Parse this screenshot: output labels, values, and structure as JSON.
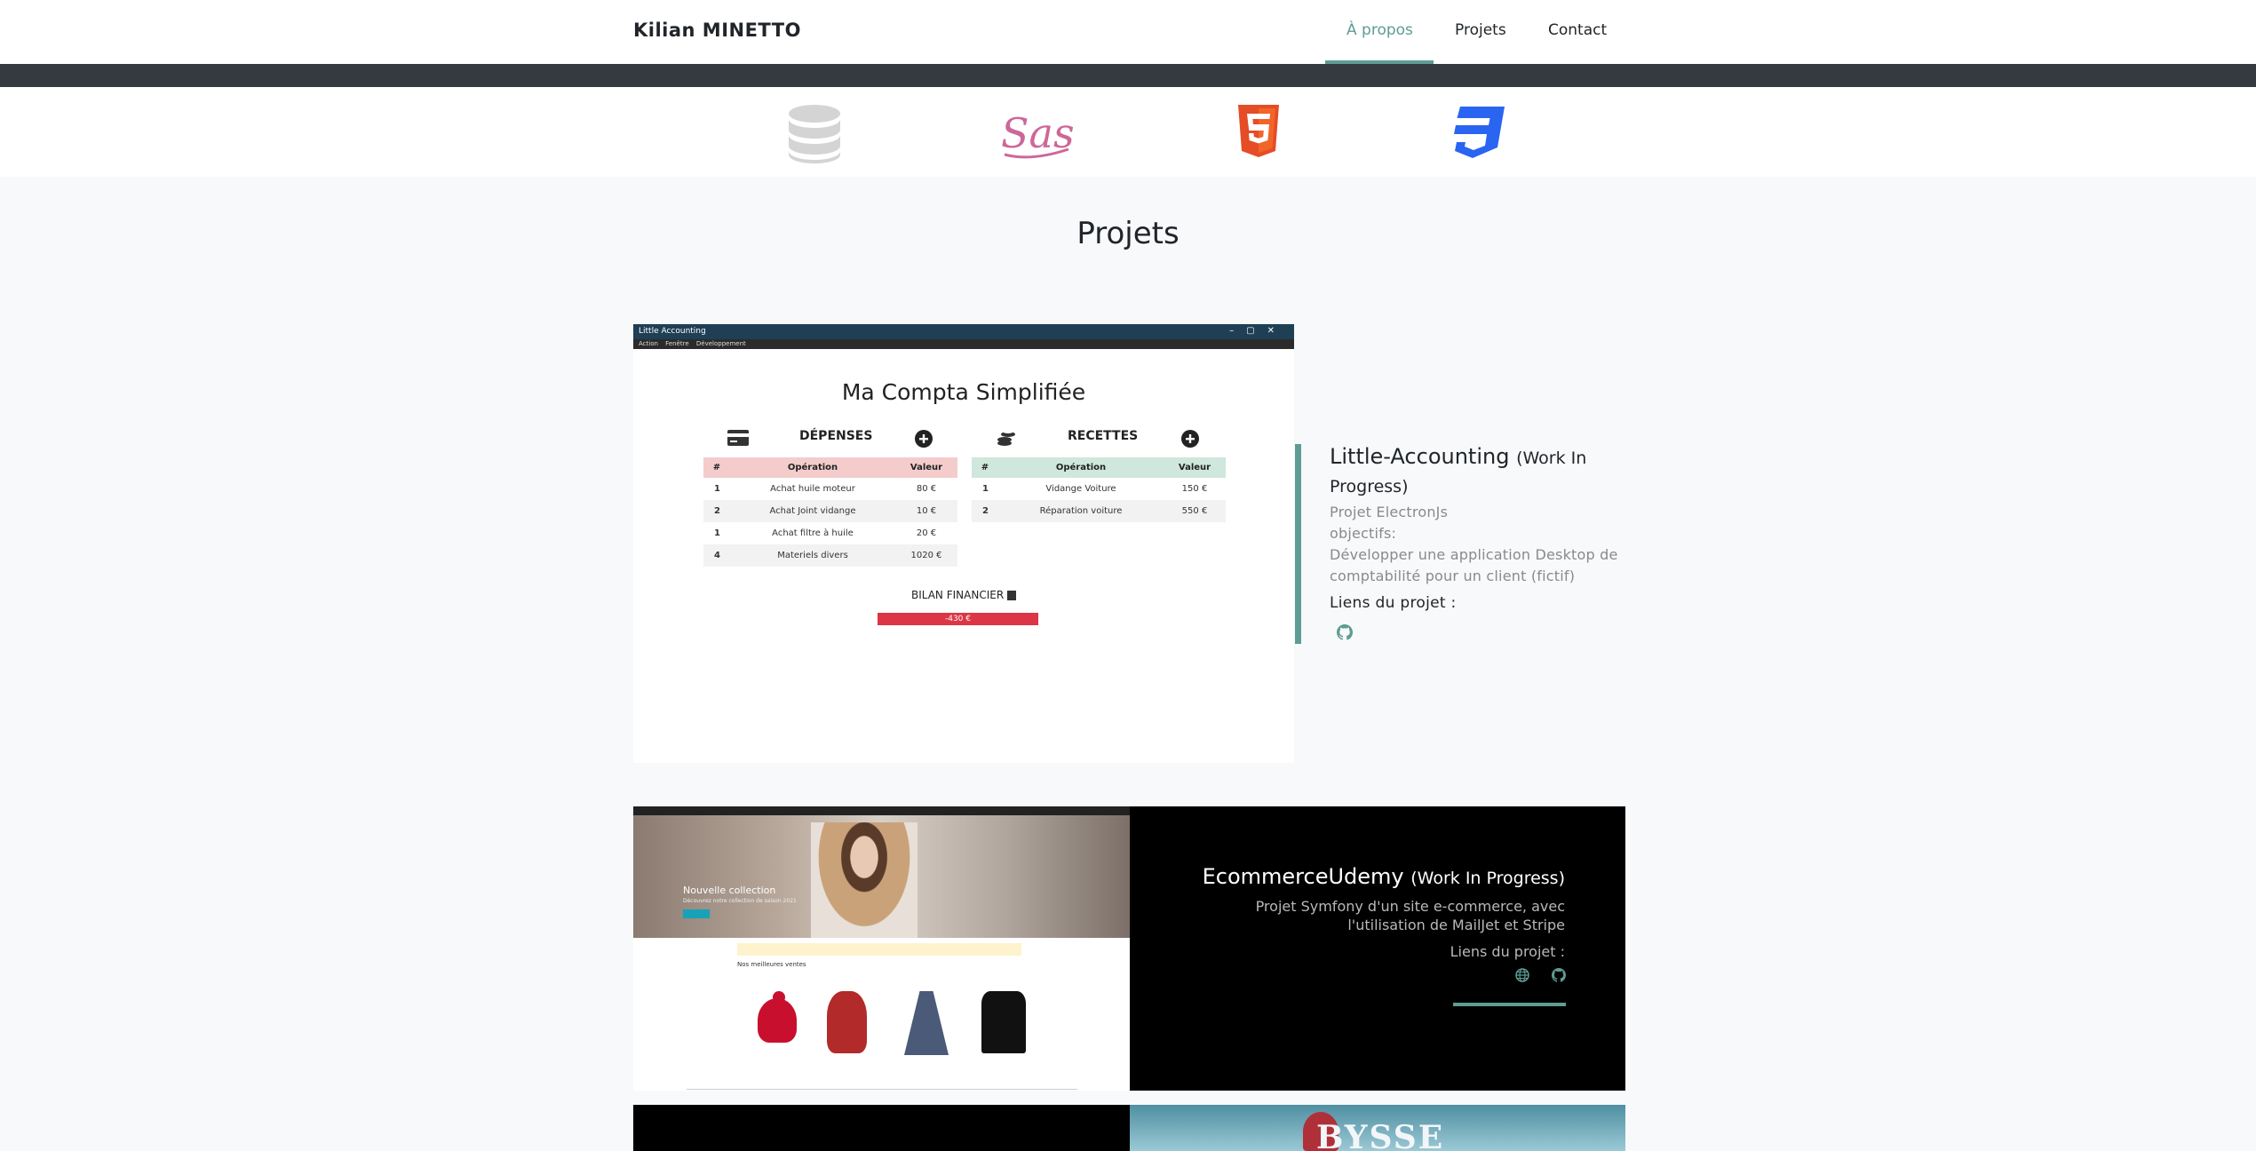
{
  "navbar": {
    "brand": "Kilian MINETTO",
    "links": [
      {
        "label": "À propos",
        "active": true
      },
      {
        "label": "Projets",
        "active": false
      },
      {
        "label": "Contact",
        "active": false
      }
    ],
    "accent_color": "#5e9c94"
  },
  "tech_icons": [
    "database-icon",
    "sass-icon",
    "html5-icon",
    "css3-icon"
  ],
  "projects_section": {
    "title": "Projets"
  },
  "project1": {
    "screenshot": {
      "window_title": "Little Accounting",
      "menu": [
        "Action",
        "Fenêtre",
        "Développement"
      ],
      "app_title": "Ma Compta Simplifiée",
      "expenses": {
        "heading": "DÉPENSES",
        "columns": [
          "#",
          "Opération",
          "Valeur"
        ],
        "rows": [
          [
            "1",
            "Achat huile moteur",
            "80 €"
          ],
          [
            "2",
            "Achat Joint vidange",
            "10 €"
          ],
          [
            "1",
            "Achat filtre à huile",
            "20 €"
          ],
          [
            "4",
            "Materiels divers",
            "1020 €"
          ]
        ]
      },
      "income": {
        "heading": "RECETTES",
        "columns": [
          "#",
          "Opération",
          "Valeur"
        ],
        "rows": [
          [
            "1",
            "Vidange Voiture",
            "150 €"
          ],
          [
            "2",
            "Réparation voiture",
            "550 €"
          ]
        ]
      },
      "balance_label": "BILAN FINANCIER",
      "balance_value": "-430 €"
    },
    "title": "Little-Accounting",
    "status": "(Work In Progress)",
    "description": [
      "Projet ElectronJs",
      "objectifs:",
      "Développer une application Desktop de comptabilité pour un client (fictif)"
    ],
    "links_label": "Liens du projet :",
    "link_icons": [
      "github-icon"
    ]
  },
  "project2": {
    "screenshot": {
      "banner_title": "Nouvelle collection",
      "banner_subtitle": "Découvrez notre collection de saison 2021",
      "section_label": "Nos meilleures ventes"
    },
    "title": "EcommerceUdemy",
    "status": "(Work In Progress)",
    "description": "Projet Symfony d'un site e-commerce, avec l'utilisation de MailJet et Stripe",
    "links_label": "Liens du projet :",
    "link_icons": [
      "globe-icon",
      "github-icon"
    ]
  },
  "project3": {
    "screenshot_logo": "BYSSE"
  }
}
